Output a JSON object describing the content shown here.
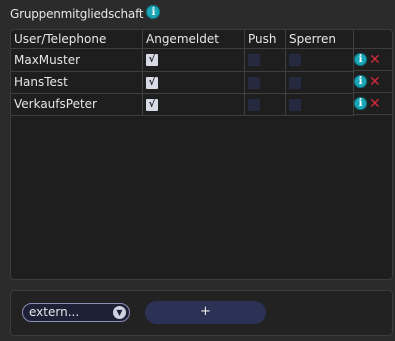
{
  "section": {
    "title": "Gruppenmitgliedschaft",
    "info_icon": "info-icon"
  },
  "table": {
    "headers": [
      "User/Telephone",
      "Angemeldet",
      "Push",
      "Sperren",
      ""
    ],
    "rows": [
      {
        "user": "MaxMuster",
        "angemeldet": true,
        "push": false,
        "sperren": false
      },
      {
        "user": "HansTest",
        "angemeldet": true,
        "push": false,
        "sperren": false
      },
      {
        "user": "VerkaufsPeter",
        "angemeldet": true,
        "push": false,
        "sperren": false
      }
    ],
    "check_glyph": "√",
    "info_glyph": "i",
    "delete_glyph": "✕"
  },
  "footer": {
    "select_value": "extern...",
    "add_label": "+"
  },
  "colors": {
    "info": "#1aa6b7",
    "delete": "#d4283a",
    "button": "#2c3256"
  }
}
